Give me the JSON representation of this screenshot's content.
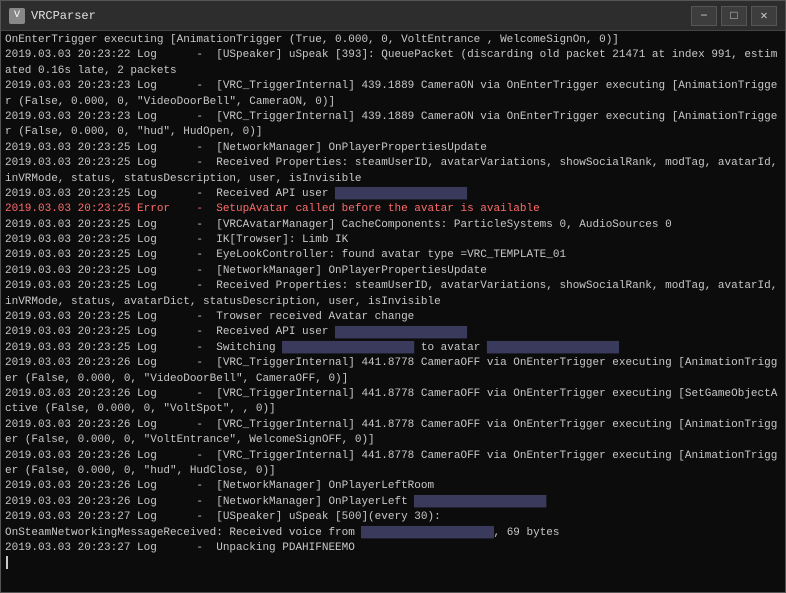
{
  "window": {
    "title": "VRCParser",
    "icon": "V"
  },
  "titlebar": {
    "minimize": "−",
    "maximize": "□",
    "close": "✕"
  },
  "logs": [
    {
      "text": "OnEnterTrigger executing [AnimationTrigger (True, 0.000, 0, VoltEntrance , WelcomeSignOn, 0)]",
      "type": "normal"
    },
    {
      "text": "2019.03.03 20:23:22 Log      -  [USpeaker] uSpeak [393]: QueuePacket (discarding old packet 21471 at index 991, estimated 0.16s late, 2 packets",
      "type": "normal"
    },
    {
      "text": "2019.03.03 20:23:23 Log      -  [VRC_TriggerInternal] 439.1889 CameraON via OnEnterTrigger executing [AnimationTrigger (False, 0.000, 0, \"VideoDoorBell\", CameraON, 0)]",
      "type": "normal"
    },
    {
      "text": "2019.03.03 20:23:23 Log      -  [VRC_TriggerInternal] 439.1889 CameraON via OnEnterTrigger executing [AnimationTrigger (False, 0.000, 0, \"hud\", HudOpen, 0)]",
      "type": "normal"
    },
    {
      "text": "2019.03.03 20:23:25 Log      -  [NetworkManager] OnPlayerPropertiesUpdate",
      "type": "normal"
    },
    {
      "text": "2019.03.03 20:23:25 Log      -  Received Properties: steamUserID, avatarVariations, showSocialRank, modTag, avatarId, inVRMode, status, statusDescription, user, isInvisible",
      "type": "normal"
    },
    {
      "text": "2019.03.03 20:23:25 Log      -  Received API user ",
      "type": "normal",
      "hasRedact": true,
      "redactSize": "large"
    },
    {
      "text": "2019.03.03 20:23:25 Error    -  SetupAvatar called before the avatar is available",
      "type": "error"
    },
    {
      "text": "2019.03.03 20:23:25 Log      -  [VRCAvatarManager] CacheComponents: ParticleSystems 0, AudioSources 0",
      "type": "normal"
    },
    {
      "text": "2019.03.03 20:23:25 Log      -  IK[Trowser]: Limb IK",
      "type": "normal"
    },
    {
      "text": "2019.03.03 20:23:25 Log      -  EyeLookController: found avatar type =VRC_TEMPLATE_01",
      "type": "normal"
    },
    {
      "text": "2019.03.03 20:23:25 Log      -  [NetworkManager] OnPlayerPropertiesUpdate",
      "type": "normal"
    },
    {
      "text": "2019.03.03 20:23:25 Log      -  Received Properties: steamUserID, avatarVariations, showSocialRank, modTag, avatarId, inVRMode, status, avatarDict, statusDescription, user, isInvisible",
      "type": "normal"
    },
    {
      "text": "2019.03.03 20:23:25 Log      -  Trowser received Avatar change",
      "type": "normal"
    },
    {
      "text": "2019.03.03 20:23:25 Log      -  Received API user ",
      "type": "normal",
      "hasRedact": true,
      "redactSize": "large"
    },
    {
      "text": "2019.03.03 20:23:25 Log      -  Switching ",
      "type": "normal",
      "hasRedact": true,
      "redactSize": "small",
      "suffix": " to avatar ",
      "suffixRedact": true,
      "suffixRedactSize": "medium"
    },
    {
      "text": "2019.03.03 20:23:26 Log      -  [VRC_TriggerInternal] 441.8778 CameraOFF via OnEnterTrigger executing [AnimationTrigger (False, 0.000, 0, \"VideoDoorBell\", CameraOFF, 0)]",
      "type": "normal"
    },
    {
      "text": "2019.03.03 20:23:26 Log      -  [VRC_TriggerInternal] 441.8778 CameraOFF via OnEnterTrigger executing [SetGameObjectActive (False, 0.000, 0, \"VoltSpot\", , 0)]",
      "type": "normal"
    },
    {
      "text": "2019.03.03 20:23:26 Log      -  [VRC_TriggerInternal] 441.8778 CameraOFF via OnEnterTrigger executing [AnimationTrigger (False, 0.000, 0, \"VoltEntrance\", WelcomeSignOFF, 0)]",
      "type": "normal"
    },
    {
      "text": "2019.03.03 20:23:26 Log      -  [VRC_TriggerInternal] 441.8778 CameraOFF via OnEnterTrigger executing [AnimationTrigger (False, 0.000, 0, \"hud\", HudClose, 0)]",
      "type": "normal"
    },
    {
      "text": "2019.03.03 20:23:26 Log      -  [NetworkManager] OnPlayerLeftRoom",
      "type": "normal"
    },
    {
      "text": "2019.03.03 20:23:26 Log      -  [NetworkManager] OnPlayerLeft ",
      "type": "normal",
      "hasRedact": true,
      "redactSize": "large"
    },
    {
      "text": "2019.03.03 20:23:27 Log      -  [USpeaker] uSpeak [500](every 30):",
      "type": "normal"
    },
    {
      "text": "OnSteamNetworkingMessageReceived: Received voice from ",
      "type": "normal",
      "hasRedact": true,
      "redactSize": "medium",
      "suffix": ", 69 bytes"
    },
    {
      "text": "2019.03.03 20:23:27 Log      -  Unpacking PDAHIFNEEMO",
      "type": "normal"
    },
    {
      "text": "",
      "type": "cursor"
    }
  ]
}
